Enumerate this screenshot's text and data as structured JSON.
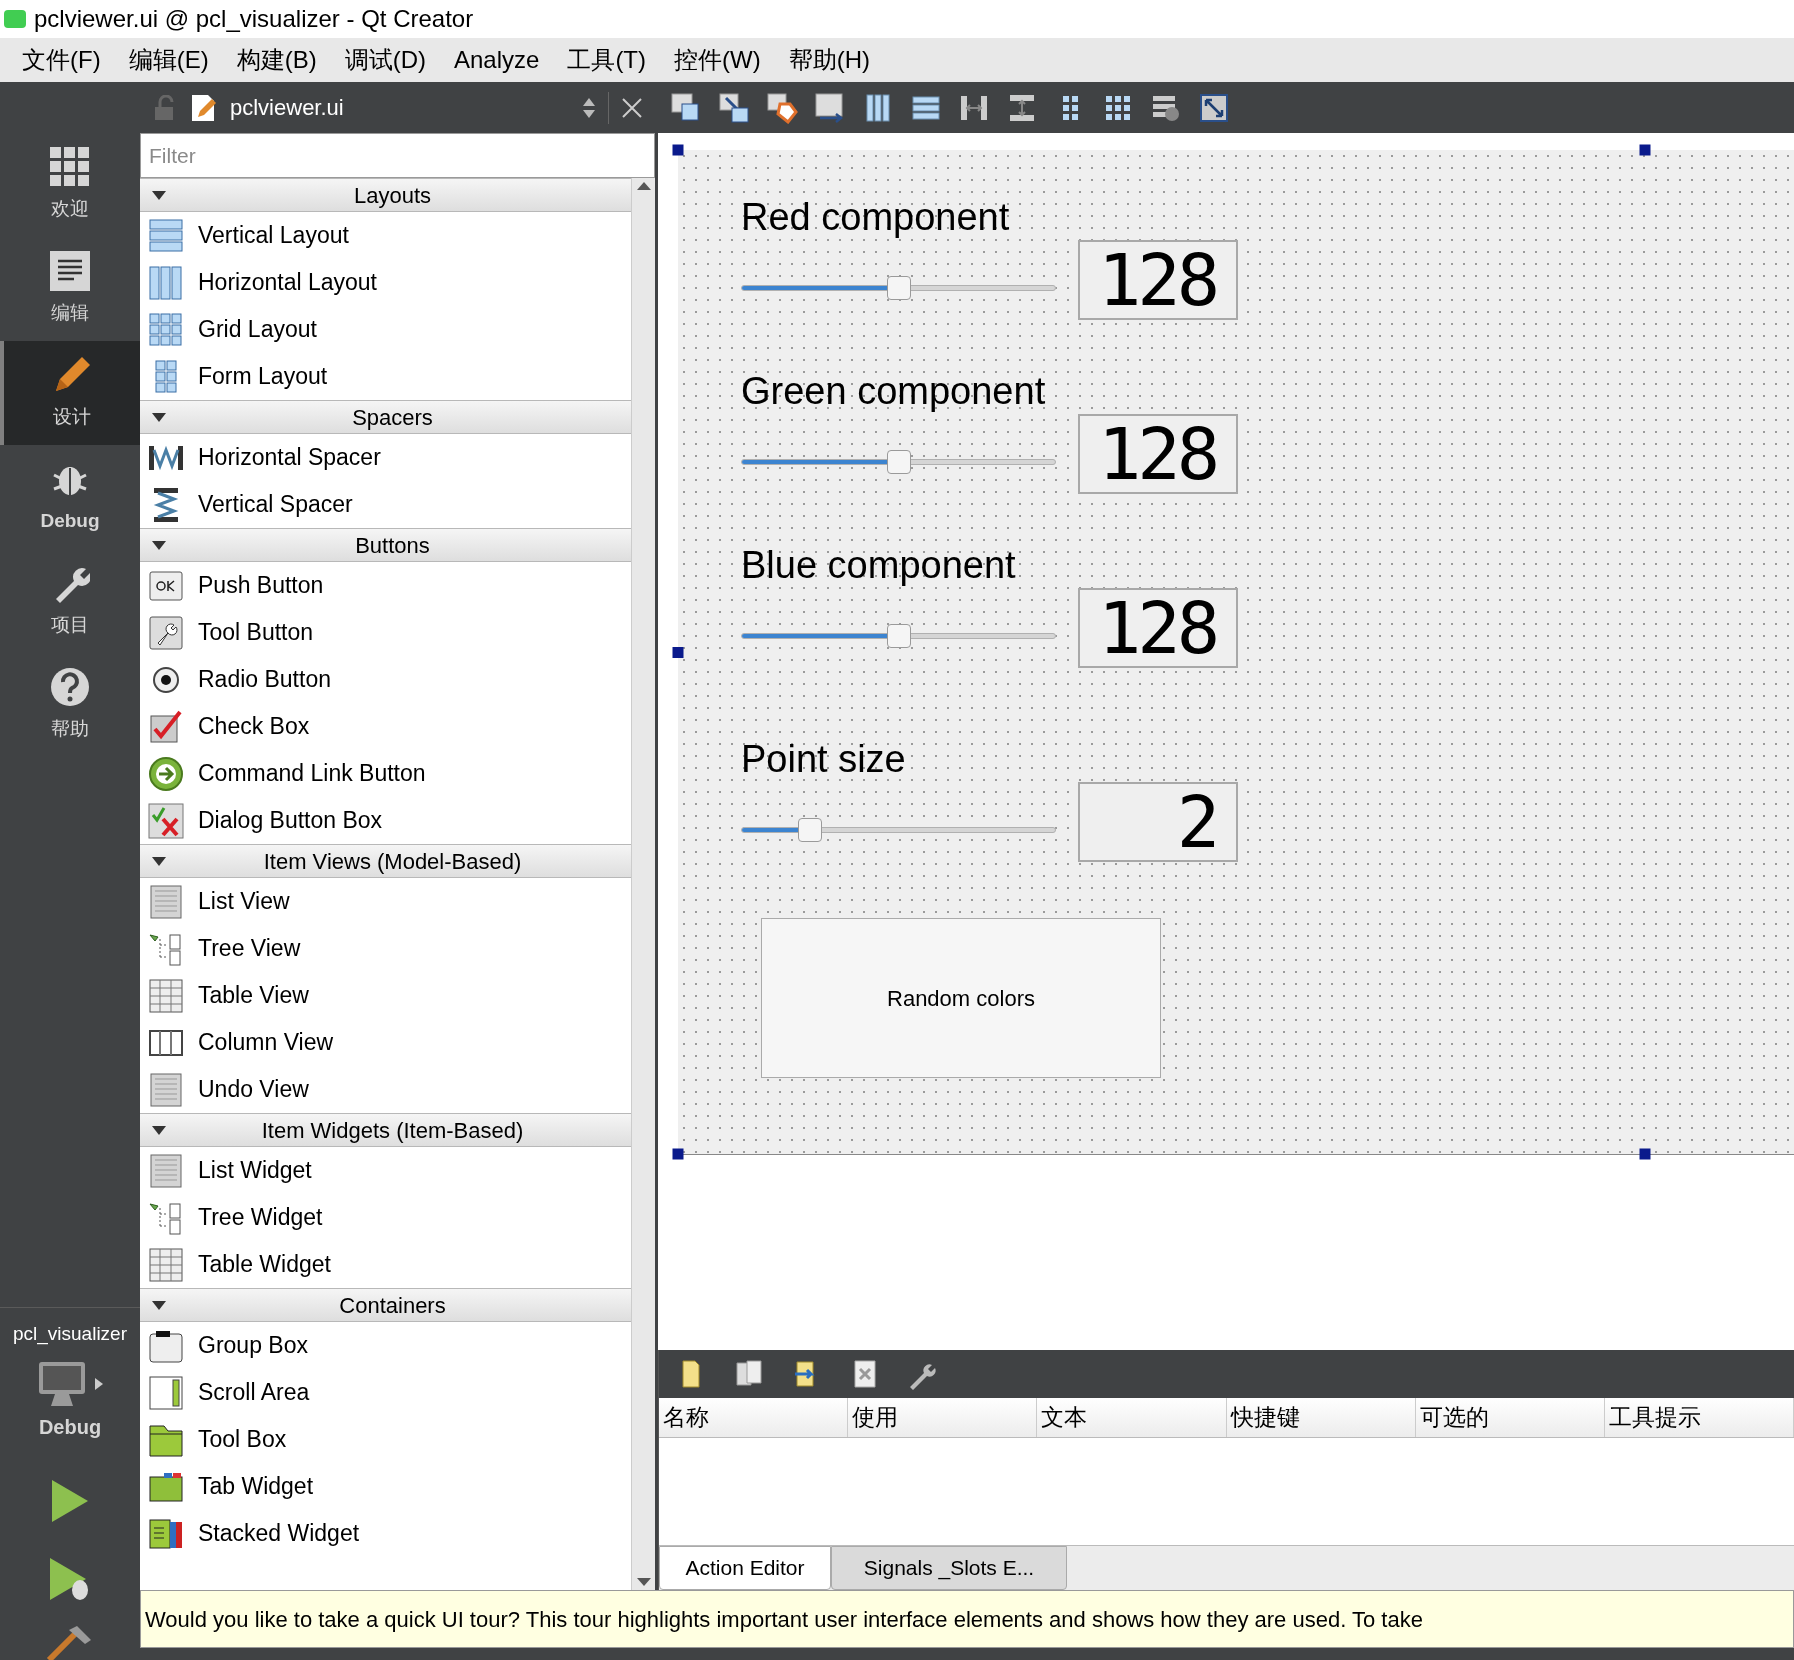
{
  "window": {
    "title": "pclviewer.ui @ pcl_visualizer - Qt Creator"
  },
  "menu": [
    "文件(F)",
    "编辑(E)",
    "构建(B)",
    "调试(D)",
    "Analyze",
    "工具(T)",
    "控件(W)",
    "帮助(H)"
  ],
  "editor_toolbar": {
    "file_name": "pclviewer.ui"
  },
  "mode_bar": [
    {
      "label": "欢迎",
      "selected": false
    },
    {
      "label": "编辑",
      "selected": false
    },
    {
      "label": "设计",
      "selected": true
    },
    {
      "label": "Debug",
      "selected": false
    },
    {
      "label": "项目",
      "selected": false
    },
    {
      "label": "帮助",
      "selected": false
    }
  ],
  "target": {
    "project": "pcl_visualizer",
    "kit": "Debug"
  },
  "widget_box": {
    "filter": {
      "placeholder": "Filter"
    },
    "categories": [
      {
        "title": "Layouts",
        "expanded": true,
        "items": [
          "Vertical Layout",
          "Horizontal Layout",
          "Grid Layout",
          "Form Layout"
        ]
      },
      {
        "title": "Spacers",
        "expanded": true,
        "items": [
          "Horizontal Spacer",
          "Vertical Spacer"
        ]
      },
      {
        "title": "Buttons",
        "expanded": true,
        "items": [
          "Push Button",
          "Tool Button",
          "Radio Button",
          "Check Box",
          "Command Link Button",
          "Dialog Button Box"
        ]
      },
      {
        "title": "Item Views (Model-Based)",
        "expanded": true,
        "items": [
          "List View",
          "Tree View",
          "Table View",
          "Column View",
          "Undo View"
        ]
      },
      {
        "title": "Item Widgets (Item-Based)",
        "expanded": true,
        "items": [
          "List Widget",
          "Tree Widget",
          "Table Widget"
        ]
      },
      {
        "title": "Containers",
        "expanded": true,
        "items": [
          "Group Box",
          "Scroll Area",
          "Tool Box",
          "Tab Widget",
          "Stacked Widget"
        ]
      }
    ]
  },
  "form": {
    "controls": [
      {
        "label": "Red component",
        "level": 0.5,
        "value": "128"
      },
      {
        "label": "Green component",
        "level": 0.5,
        "value": "128"
      },
      {
        "label": "Blue component",
        "level": 0.5,
        "value": "128"
      },
      {
        "label": "Point size",
        "level": 0.22,
        "value": "2"
      }
    ],
    "button": "Random colors"
  },
  "action_editor": {
    "columns": [
      "名称",
      "使用",
      "文本",
      "快捷键",
      "可选的",
      "工具提示"
    ],
    "tabs": [
      {
        "label": "Action Editor",
        "selected": true
      },
      {
        "label": "Signals _Slots E...",
        "selected": false
      }
    ]
  },
  "tour_bar": {
    "text": "Would you like to take a quick UI tour? This tour highlights important user interface elements and shows how they are used. To take"
  }
}
